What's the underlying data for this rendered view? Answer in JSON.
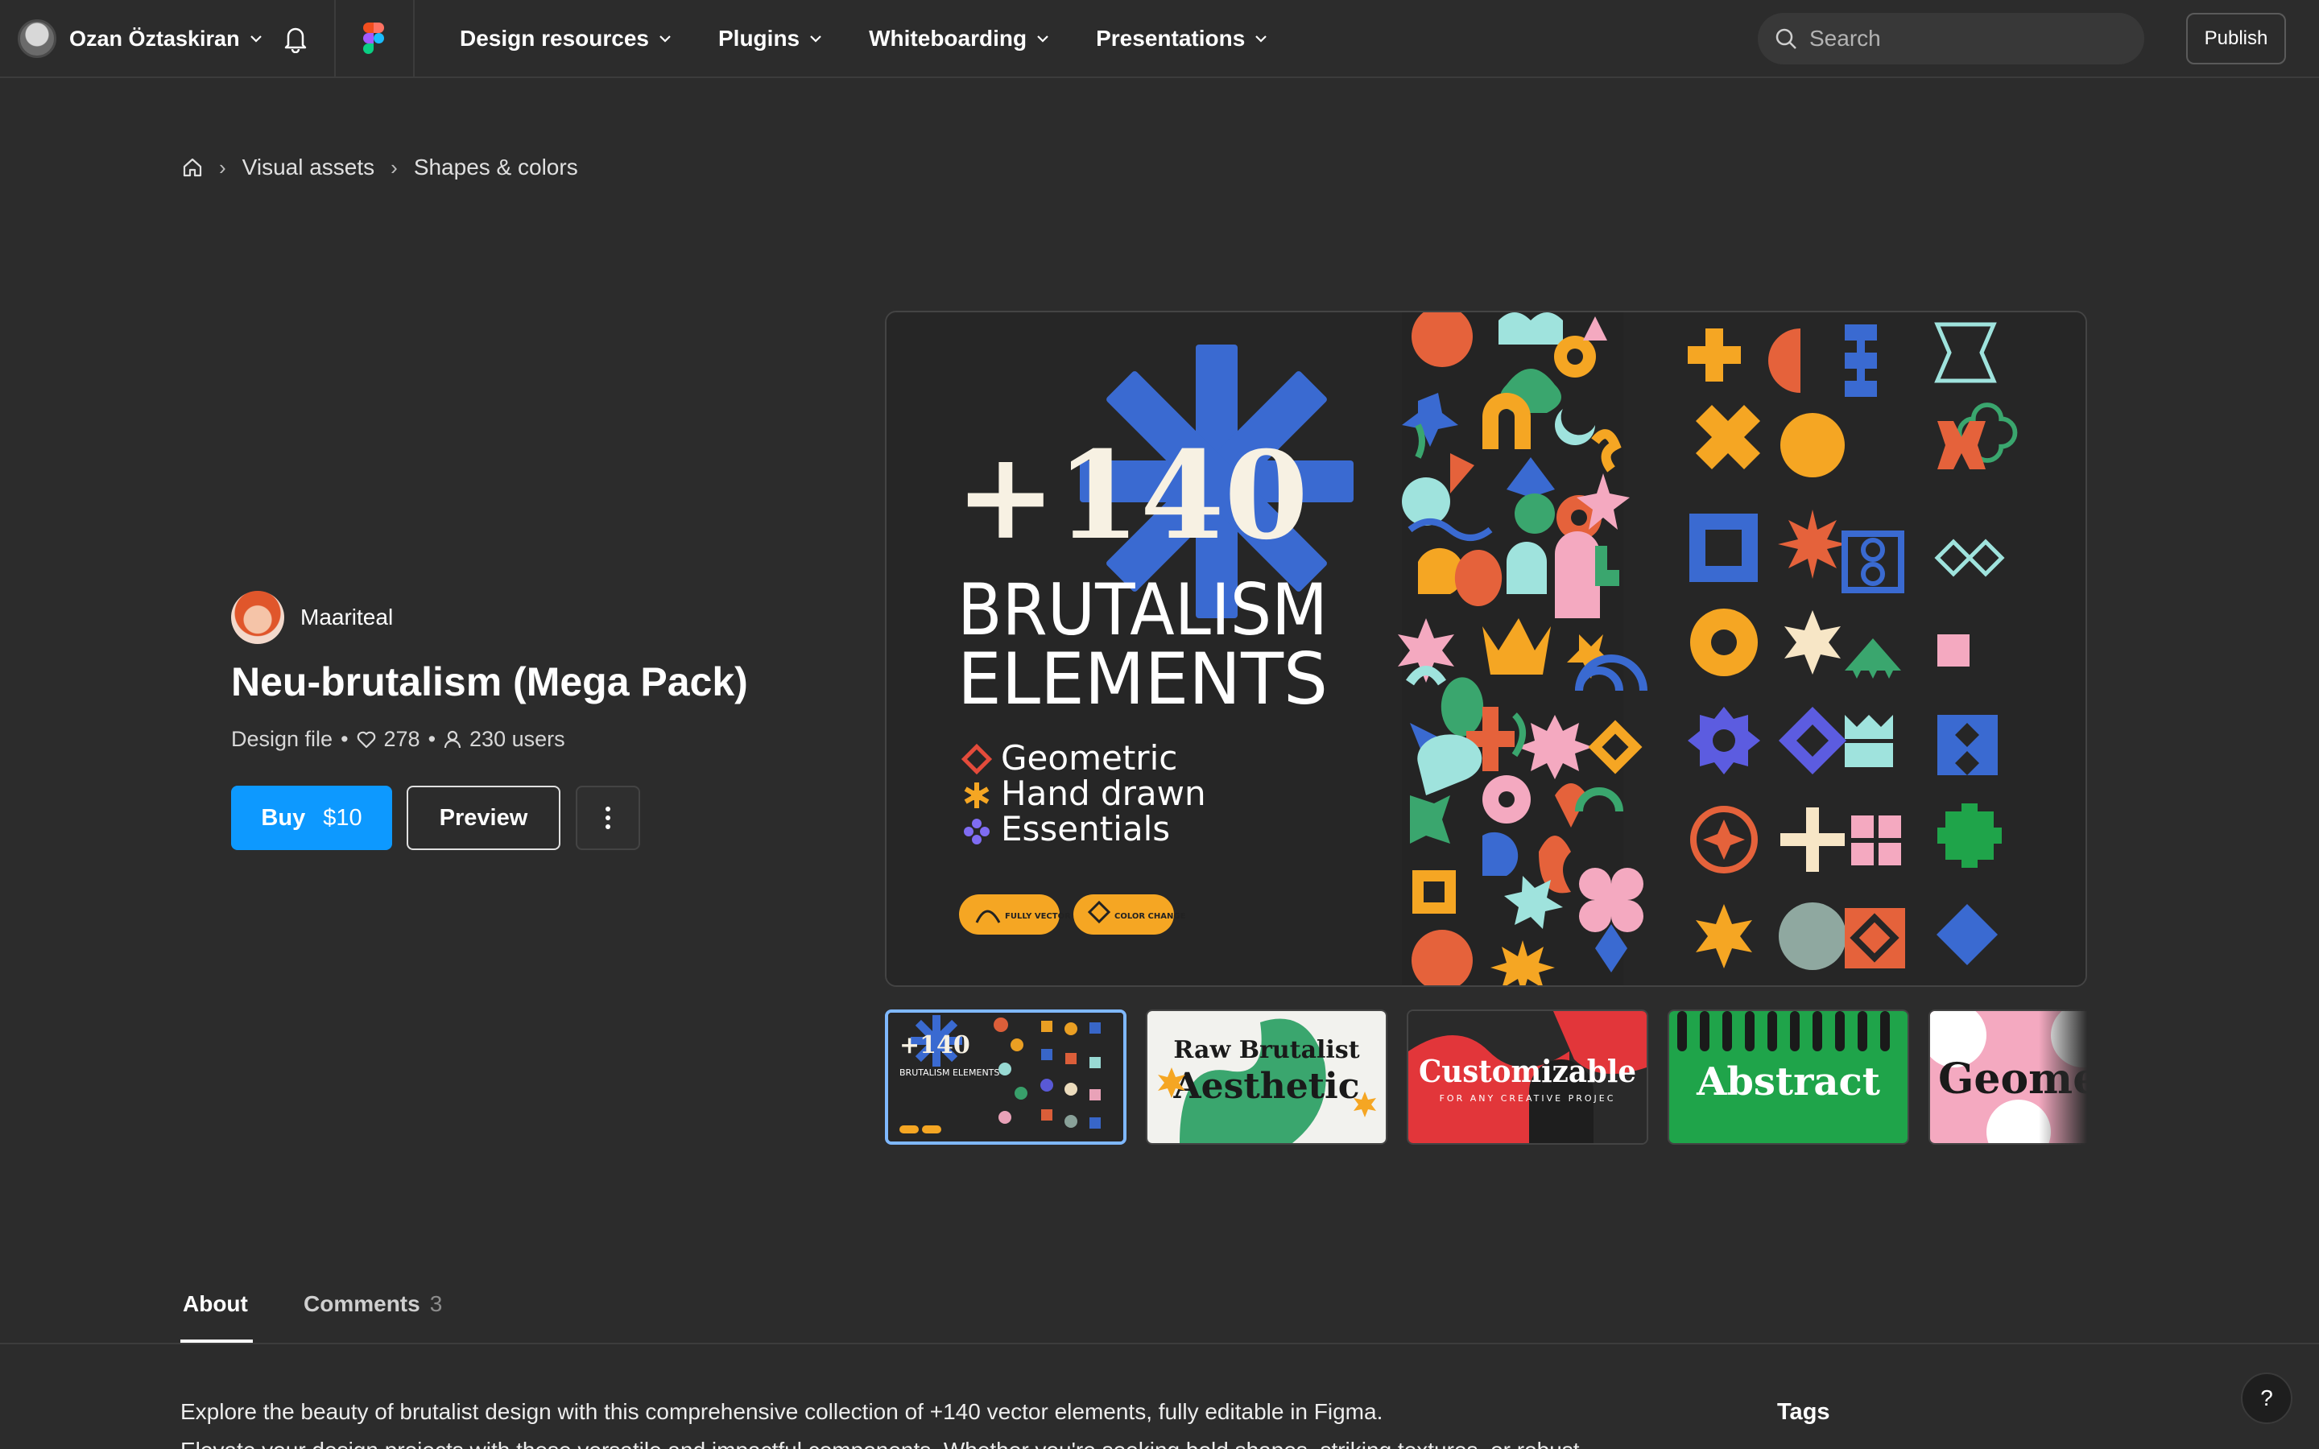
{
  "user": {
    "name": "Ozan Öztaskiran"
  },
  "nav": {
    "links": [
      "Design resources",
      "Plugins",
      "Whiteboarding",
      "Presentations"
    ]
  },
  "search": {
    "placeholder": "Search"
  },
  "publish_label": "Publish",
  "breadcrumb": [
    "Visual assets",
    "Shapes & colors"
  ],
  "product": {
    "creator": "Maariteal",
    "title": "Neu-brutalism (Mega Pack)",
    "type": "Design file",
    "likes": "278",
    "users": "230 users",
    "buy_label": "Buy",
    "price": "$10",
    "preview_label": "Preview"
  },
  "hero": {
    "big_number": "+140",
    "line1": "BRUTALISM",
    "line2": "ELEMENTS",
    "features": [
      "Geometric",
      "Hand drawn",
      "Essentials"
    ],
    "badges": [
      "FULLY VECTOR",
      "COLOR CHANGE"
    ]
  },
  "thumbnails": [
    {
      "text": "+140",
      "sub": "BRUTALISM ELEMENTS"
    },
    {
      "text": "Raw Brutalist",
      "sub": "Aesthetic"
    },
    {
      "text": "Customizable",
      "sub": "FOR ANY CREATIVE PROJEC"
    },
    {
      "text": "Abstract",
      "sub": ""
    },
    {
      "text": "Geome",
      "sub": ""
    }
  ],
  "tabs": {
    "about": "About",
    "comments": "Comments",
    "comments_count": "3"
  },
  "about": {
    "paragraph1": "Explore the beauty of brutalist design with this comprehensive collection of +140 vector elements, fully editable in Figma.",
    "paragraph2": "Elevate your design projects with these versatile and impactful components. Whether you're seeking bold shapes, striking textures, or robust",
    "tags_heading": "Tags"
  },
  "help_label": "?",
  "colors": {
    "background": "#2c2c2c",
    "primary_button": "#0d99ff",
    "brand_blue": "#3a6ad1",
    "orange": "#f5a623"
  }
}
